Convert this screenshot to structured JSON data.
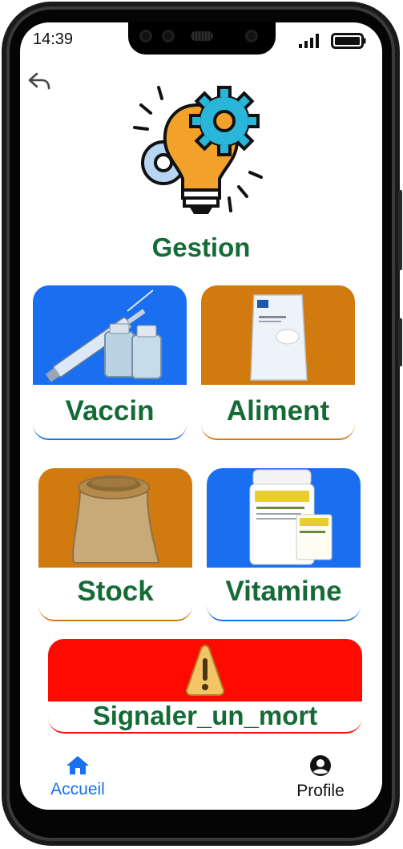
{
  "status_bar": {
    "time": "14:39"
  },
  "header": {
    "title": "Gestion",
    "back_icon": "back-arrow-icon",
    "hero_icon": "lightbulb-gears-icon"
  },
  "cards": [
    {
      "label": "Vaccin",
      "image": "vaccine-vial-syringe",
      "color": "#1a6ff0"
    },
    {
      "label": "Aliment",
      "image": "feed-bag",
      "color": "#d17a10"
    },
    {
      "label": "Stock",
      "image": "grain-sack",
      "color": "#d17a10"
    },
    {
      "label": "Vitamine",
      "image": "vitamin-tub",
      "color": "#1a6ff0"
    }
  ],
  "alert": {
    "label": "Signaler_un_mort",
    "image": "warning-icon",
    "color": "#ff0a00"
  },
  "bottom_nav": [
    {
      "label": "Accueil",
      "icon": "home-icon",
      "active": true,
      "color": "#1a6ff0"
    },
    {
      "label": "Profile",
      "icon": "account-circle-icon",
      "active": false,
      "color": "#111111"
    }
  ],
  "colors": {
    "title_green": "#156b36"
  }
}
